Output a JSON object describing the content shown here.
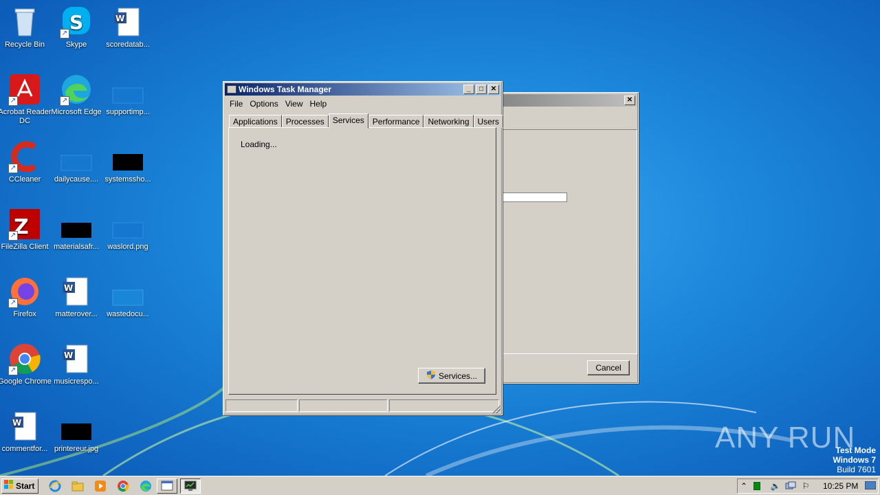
{
  "desktop_icons": [
    {
      "label": "Recycle Bin"
    },
    {
      "label": "Skype"
    },
    {
      "label": "scoredatab..."
    },
    {
      "label": "Acrobat Reader DC"
    },
    {
      "label": "Microsoft Edge"
    },
    {
      "label": "supportimp..."
    },
    {
      "label": "CCleaner"
    },
    {
      "label": "dailycause...."
    },
    {
      "label": "systemssho..."
    },
    {
      "label": "FileZilla Client"
    },
    {
      "label": "materialsafr..."
    },
    {
      "label": "waslord.png"
    },
    {
      "label": "Firefox"
    },
    {
      "label": "matterover..."
    },
    {
      "label": "wastedocu..."
    },
    {
      "label": "Google Chrome"
    },
    {
      "label": "musicrespo..."
    },
    {
      "label": "commentfor..."
    },
    {
      "label": "printereur.jpg"
    }
  ],
  "task_manager": {
    "title": "Windows Task Manager",
    "menu": [
      "File",
      "Options",
      "View",
      "Help"
    ],
    "tabs": [
      "Applications",
      "Processes",
      "Services",
      "Performance",
      "Networking",
      "Users"
    ],
    "active_tab": "Services",
    "loading_text": "Loading...",
    "services_button": "Services..."
  },
  "back_dialog": {
    "cancel_button": "Cancel"
  },
  "taskbar": {
    "start_label": "Start",
    "clock": "10:25 PM"
  },
  "watermark": {
    "line1": "Test Mode",
    "line2": "Windows 7",
    "line3": "Build 7601",
    "brand": "ANY RUN"
  }
}
